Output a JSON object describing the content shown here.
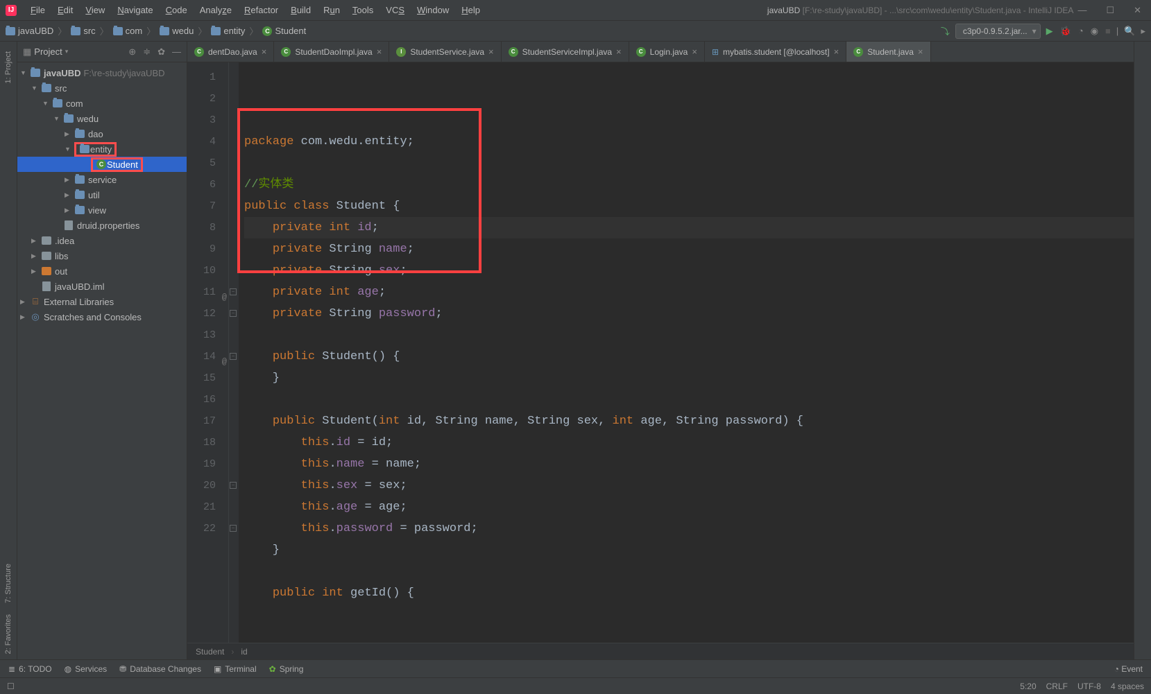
{
  "window": {
    "title_project": "javaUBD",
    "title_path": "[F:\\re-study\\javaUBD] - ...\\src\\com\\wedu\\entity\\Student.java - IntelliJ IDEA"
  },
  "menus": [
    "File",
    "Edit",
    "View",
    "Navigate",
    "Code",
    "Analyze",
    "Refactor",
    "Build",
    "Run",
    "Tools",
    "VCS",
    "Window",
    "Help"
  ],
  "breadcrumbs": [
    "javaUBD",
    "src",
    "com",
    "wedu",
    "entity",
    "Student"
  ],
  "jar_selector": "c3p0-0.9.5.2.jar...",
  "project_panel": {
    "title": "Project",
    "tree": [
      {
        "indent": 4,
        "arrow": "▼",
        "icon": "folder",
        "label": "javaUBD",
        "suffix": " F:\\re-study\\javaUBD",
        "bold": true
      },
      {
        "indent": 20,
        "arrow": "▼",
        "icon": "folder",
        "label": "src"
      },
      {
        "indent": 36,
        "arrow": "▼",
        "icon": "folder",
        "label": "com"
      },
      {
        "indent": 52,
        "arrow": "▼",
        "icon": "folder",
        "label": "wedu"
      },
      {
        "indent": 68,
        "arrow": "▶",
        "icon": "folder",
        "label": "dao"
      },
      {
        "indent": 68,
        "arrow": "▼",
        "icon": "folder",
        "label": "entity",
        "highlight": true
      },
      {
        "indent": 92,
        "arrow": "",
        "icon": "class",
        "label": "Student",
        "selected": true,
        "highlight": true
      },
      {
        "indent": 68,
        "arrow": "▶",
        "icon": "folder",
        "label": "service"
      },
      {
        "indent": 68,
        "arrow": "▶",
        "icon": "folder",
        "label": "util"
      },
      {
        "indent": 68,
        "arrow": "▶",
        "icon": "folder",
        "label": "view"
      },
      {
        "indent": 52,
        "arrow": "",
        "icon": "file",
        "label": "druid.properties"
      },
      {
        "indent": 20,
        "arrow": "▶",
        "icon": "folder-gray",
        "label": ".idea"
      },
      {
        "indent": 20,
        "arrow": "▶",
        "icon": "folder-gray",
        "label": "libs"
      },
      {
        "indent": 20,
        "arrow": "▶",
        "icon": "folder-orange",
        "label": "out"
      },
      {
        "indent": 20,
        "arrow": "",
        "icon": "file",
        "label": "javaUBD.iml"
      },
      {
        "indent": 4,
        "arrow": "▶",
        "icon": "lib",
        "label": "External Libraries"
      },
      {
        "indent": 4,
        "arrow": "▶",
        "icon": "scratch",
        "label": "Scratches and Consoles"
      }
    ]
  },
  "tabs": [
    {
      "icon": "class",
      "label": "dentDao.java",
      "active": false
    },
    {
      "icon": "class",
      "label": "StudentDaoImpl.java",
      "active": false
    },
    {
      "icon": "interface",
      "label": "StudentService.java",
      "active": false
    },
    {
      "icon": "class",
      "label": "StudentServiceImpl.java",
      "active": false
    },
    {
      "icon": "class",
      "label": "Login.java",
      "active": false
    },
    {
      "icon": "db",
      "label": "mybatis.student [@localhost]",
      "active": false
    },
    {
      "icon": "class",
      "label": "Student.java",
      "active": true
    }
  ],
  "code_lines": [
    {
      "n": 1,
      "html": "<span class='kw'>package</span> com.wedu.entity;"
    },
    {
      "n": 2,
      "html": ""
    },
    {
      "n": 3,
      "html": "<span class='comment'>//</span><span class='comment-cn'>实体类</span>"
    },
    {
      "n": 4,
      "html": "<span class='kw'>public class</span> Student {"
    },
    {
      "n": 5,
      "html": "    <span class='kw'>private int</span> <span class='field'>id</span>;",
      "caret": true
    },
    {
      "n": 6,
      "html": "    <span class='kw'>private</span> String <span class='field'>name</span>;"
    },
    {
      "n": 7,
      "html": "    <span class='kw'>private</span> String <span class='field'>sex</span>;"
    },
    {
      "n": 8,
      "html": "    <span class='kw'>private int</span> <span class='field'>age</span>;"
    },
    {
      "n": 9,
      "html": "    <span class='kw'>private</span> String <span class='field'>password</span>;"
    },
    {
      "n": 10,
      "html": ""
    },
    {
      "n": 11,
      "html": "    <span class='kw'>public</span> Student() {",
      "mark": "@",
      "fold": "-"
    },
    {
      "n": 12,
      "html": "    }",
      "fold": "-"
    },
    {
      "n": 13,
      "html": ""
    },
    {
      "n": 14,
      "html": "    <span class='kw'>public</span> Student(<span class='kw'>int</span> id, String name, String sex, <span class='kw'>int</span> age, String password) {",
      "mark": "@",
      "fold": "-"
    },
    {
      "n": 15,
      "html": "        <span class='kw'>this</span>.<span class='field'>id</span> = id;"
    },
    {
      "n": 16,
      "html": "        <span class='kw'>this</span>.<span class='field'>name</span> = name;"
    },
    {
      "n": 17,
      "html": "        <span class='kw'>this</span>.<span class='field'>sex</span> = sex;"
    },
    {
      "n": 18,
      "html": "        <span class='kw'>this</span>.<span class='field'>age</span> = age;"
    },
    {
      "n": 19,
      "html": "        <span class='kw'>this</span>.<span class='field'>password</span> = password;"
    },
    {
      "n": 20,
      "html": "    }",
      "fold": "-"
    },
    {
      "n": 21,
      "html": ""
    },
    {
      "n": 22,
      "html": "    <span class='kw'>public int</span> getId() {",
      "fold": "-"
    }
  ],
  "editor_breadcrumb": [
    "Student",
    "id"
  ],
  "left_tabs": [
    "1: Project",
    "7: Structure",
    "2: Favorites"
  ],
  "bottom_tools": [
    "6: TODO",
    "Services",
    "Database Changes",
    "Terminal",
    "Spring"
  ],
  "bottom_right": "Event",
  "status": {
    "pos": "5:20",
    "eol": "CRLF",
    "enc": "UTF-8",
    "indent": "4 spaces"
  }
}
